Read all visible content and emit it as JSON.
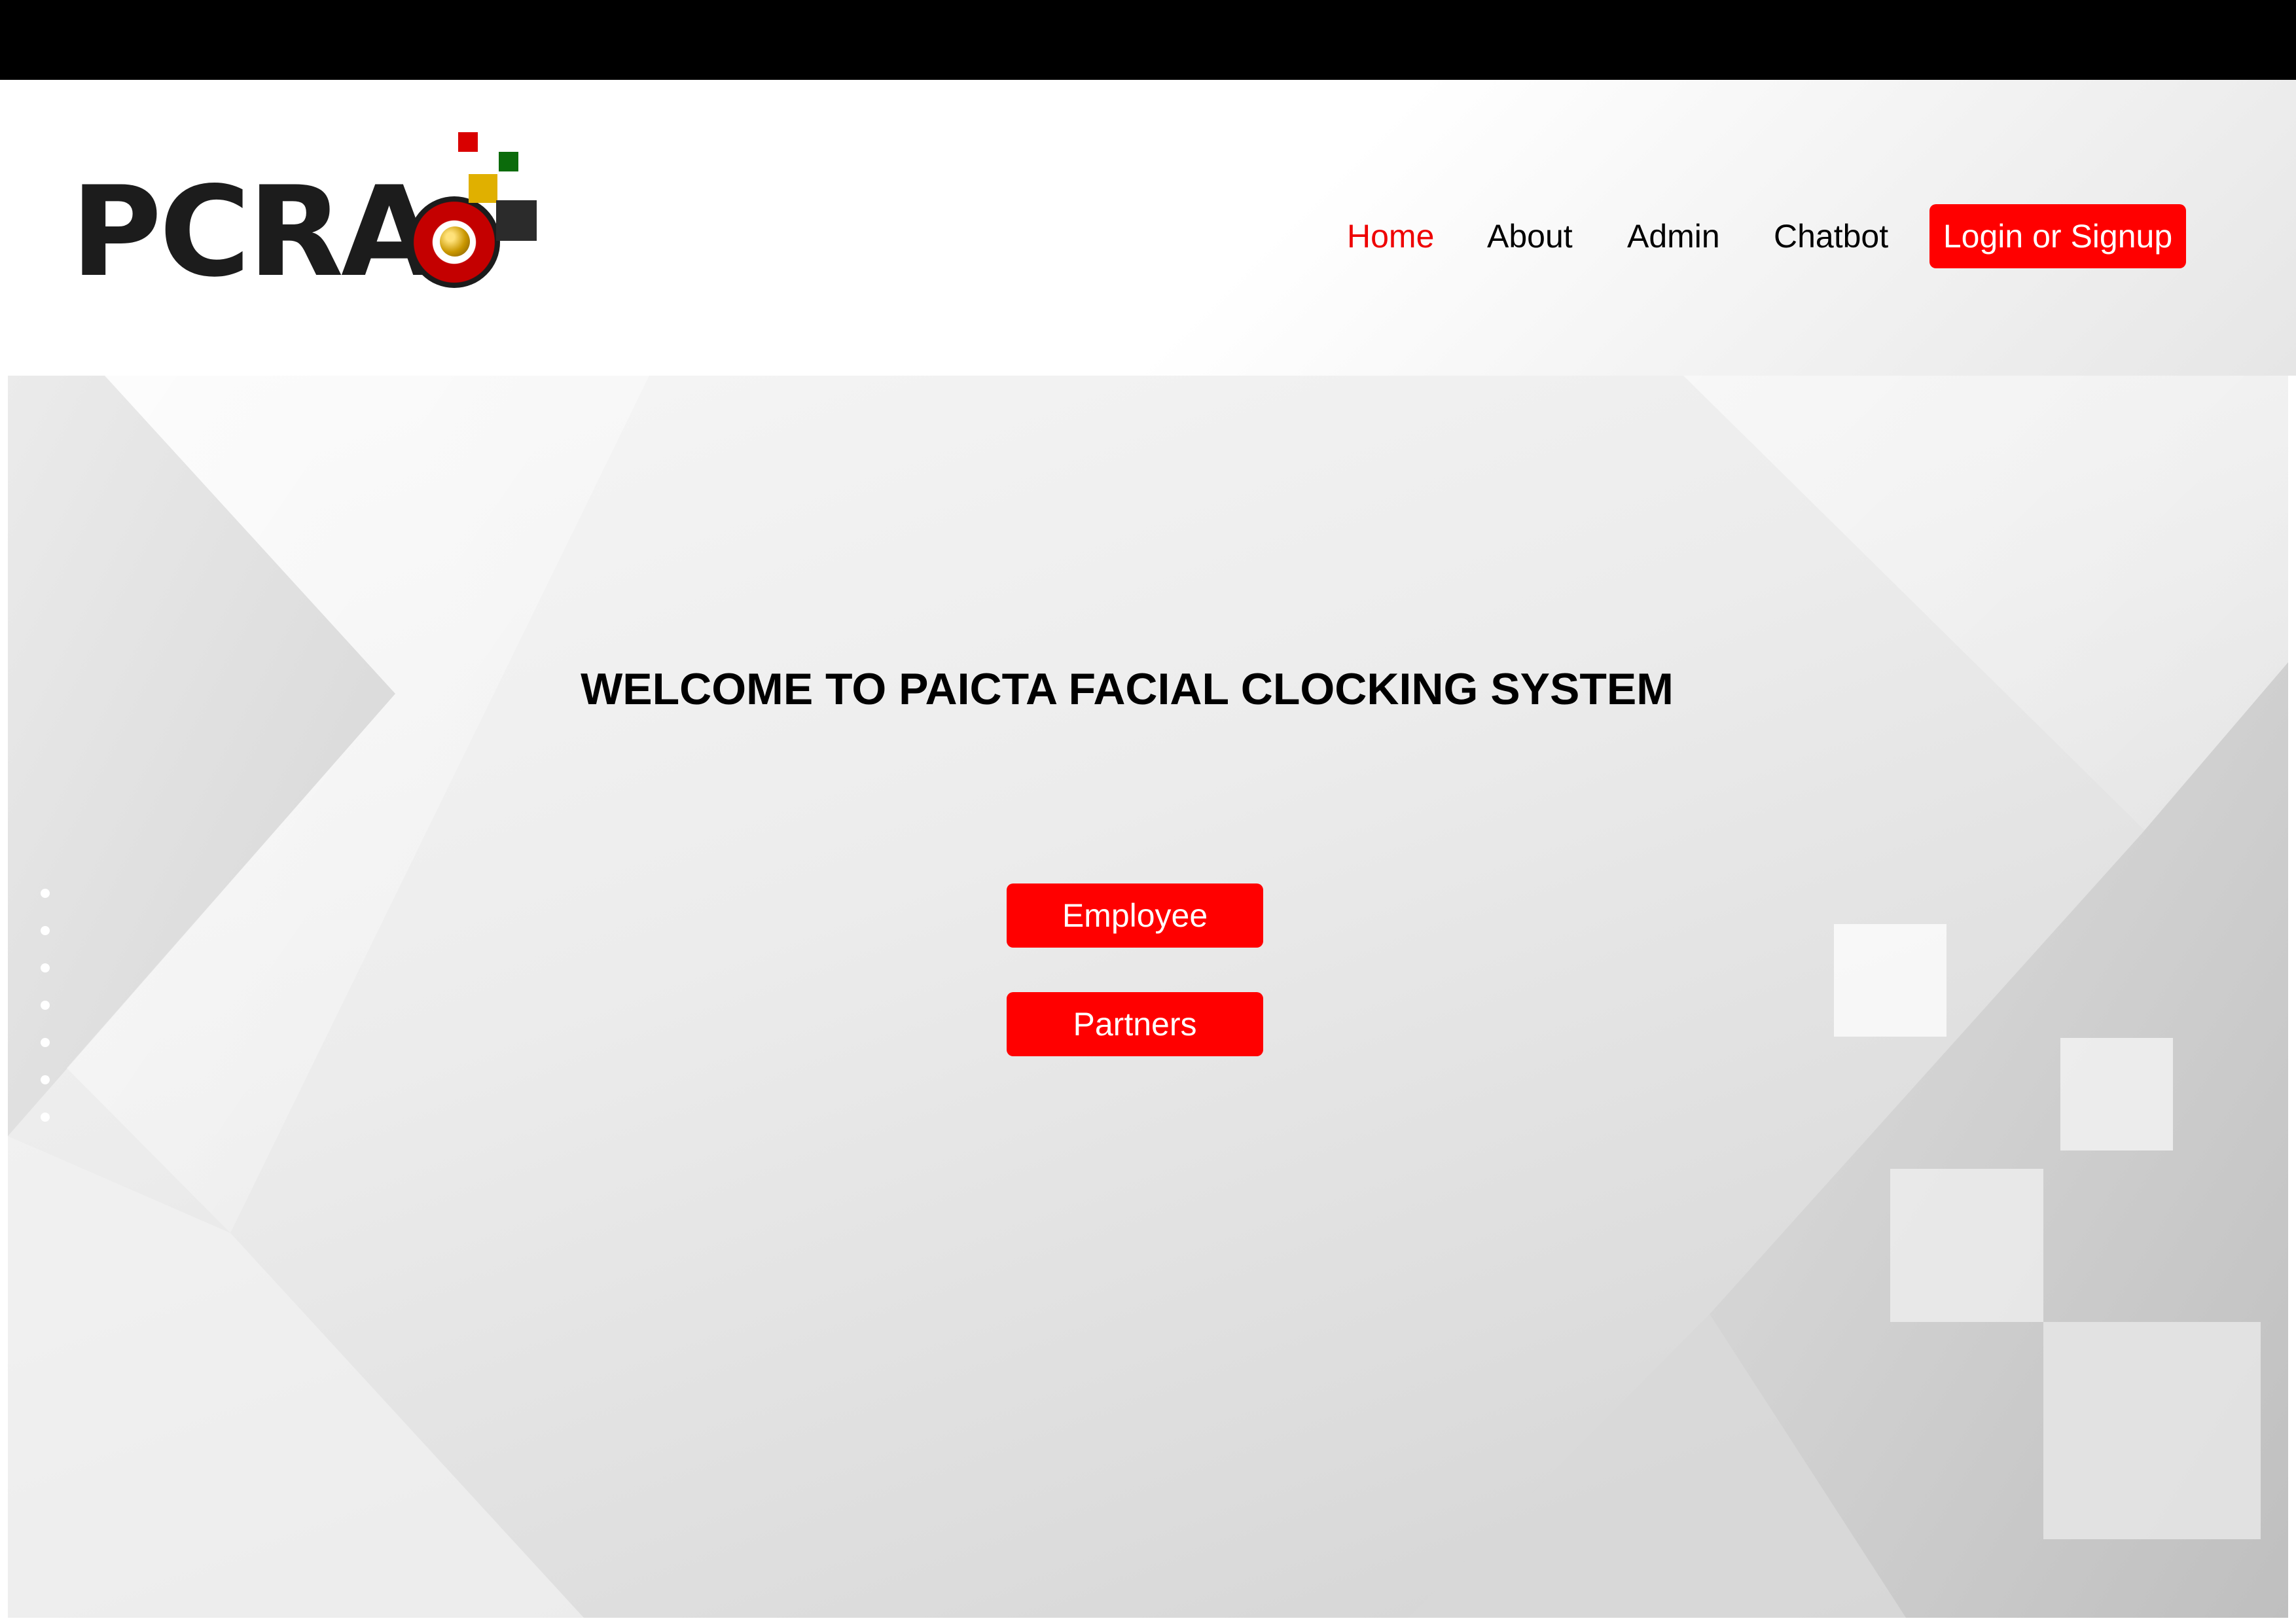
{
  "logo": {
    "letters": [
      "P",
      "C",
      "R",
      "A"
    ],
    "name": "PCRAQ",
    "colors": {
      "red": "#d90000",
      "green": "#0b6b0b",
      "yellow": "#e0b000",
      "dark": "#2b2b2b"
    }
  },
  "nav": {
    "home": "Home",
    "about": "About",
    "admin": "Admin",
    "chatbot": "Chatbot",
    "login": "Login or Signup"
  },
  "hero": {
    "title": "WELCOME TO PAICTA FACIAL CLOCKING SYSTEM",
    "employee_button": "Employee",
    "partners_button": "Partners"
  },
  "theme": {
    "accent": "#ff0000",
    "active_nav": "#ee0000",
    "top_bar": "#000000"
  }
}
